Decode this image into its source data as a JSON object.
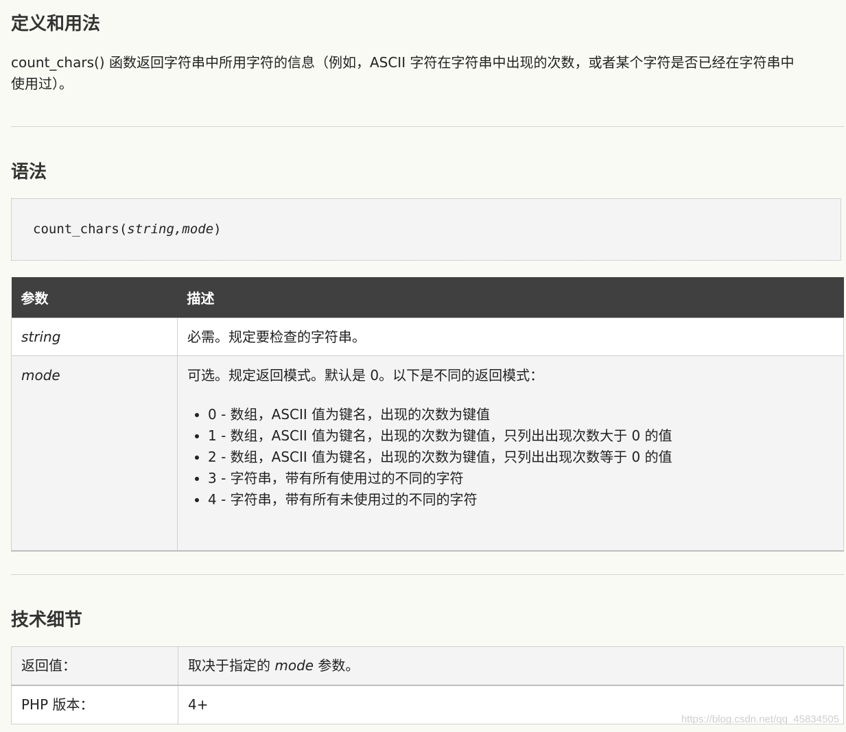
{
  "definition": {
    "title": "定义和用法",
    "text_line1": "count_chars() 函数返回字符串中所用字符的信息（例如，ASCII 字符在字符串中出现的次数，或者某个字符是否已经在字符串中",
    "text_line2": "使用过）。"
  },
  "syntax": {
    "title": "语法",
    "code_prefix": "count_chars(",
    "code_arg1": "string",
    "code_sep": ",",
    "code_arg2": "mode",
    "code_suffix": ")"
  },
  "params_table": {
    "headers": [
      "参数",
      "描述"
    ],
    "rows": [
      {
        "name": "string",
        "description": "必需。规定要检查的字符串。"
      },
      {
        "name": "mode",
        "description": "可选。规定返回模式。默认是 0。以下是不同的返回模式：",
        "modes": [
          "0 - 数组，ASCII 值为键名，出现的次数为键值",
          "1 - 数组，ASCII 值为键名，出现的次数为键值，只列出出现次数大于 0 的值",
          "2 - 数组，ASCII 值为键名，出现的次数为键值，只列出出现次数等于 0 的值",
          "3 - 字符串，带有所有使用过的不同的字符",
          "4 - 字符串，带有所有未使用过的不同的字符"
        ]
      }
    ]
  },
  "tech": {
    "title": "技术细节",
    "rows": [
      {
        "label": "返回值：",
        "value_prefix": "取决于指定的 ",
        "value_em": "mode",
        "value_suffix": " 参数。"
      },
      {
        "label": "PHP 版本：",
        "value": "4+"
      }
    ]
  },
  "watermark": "https://blog.csdn.net/qq_45834505"
}
